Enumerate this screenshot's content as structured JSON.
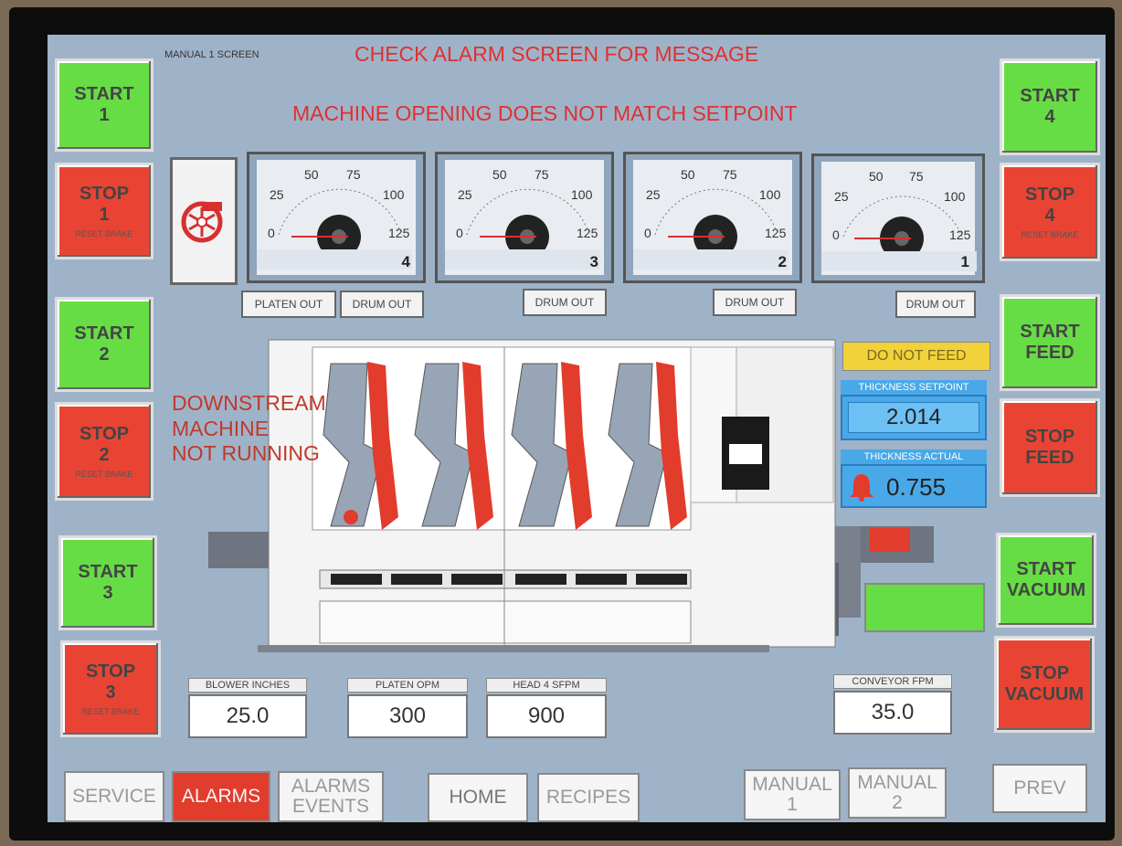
{
  "screen": {
    "title": "MANUAL 1 SCREEN",
    "alarm_banner": "CHECK ALARM SCREEN FOR MESSAGE",
    "warning": "MACHINE OPENING DOES NOT MATCH SETPOINT",
    "downstream_msg": [
      "DOWNSTREAM",
      "MACHINE",
      "NOT RUNNING"
    ]
  },
  "left_buttons": [
    {
      "line1": "START",
      "line2": "1"
    },
    {
      "line1": "STOP",
      "line2": "1",
      "sub": "RESET BRAKE"
    },
    {
      "line1": "START",
      "line2": "2"
    },
    {
      "line1": "STOP",
      "line2": "2",
      "sub": "RESET BRAKE"
    },
    {
      "line1": "START",
      "line2": "3"
    },
    {
      "line1": "STOP",
      "line2": "3",
      "sub": "RESET BRAKE"
    }
  ],
  "right_buttons": [
    {
      "line1": "START",
      "line2": "4"
    },
    {
      "line1": "STOP",
      "line2": "4",
      "sub": "RESET BRAKE"
    },
    {
      "line1": "START",
      "line2": "FEED"
    },
    {
      "line1": "STOP",
      "line2": "FEED"
    },
    {
      "line1": "START",
      "line2": "VACUUM"
    },
    {
      "line1": "STOP",
      "line2": "VACUUM"
    }
  ],
  "gauges": [
    {
      "index": "4",
      "ticks": [
        "0",
        "25",
        "50",
        "75",
        "100",
        "125"
      ]
    },
    {
      "index": "3",
      "ticks": [
        "0",
        "25",
        "50",
        "75",
        "100",
        "125"
      ]
    },
    {
      "index": "2",
      "ticks": [
        "0",
        "25",
        "50",
        "75",
        "100",
        "125"
      ]
    },
    {
      "index": "1",
      "ticks": [
        "0",
        "25",
        "50",
        "75",
        "100",
        "125"
      ]
    }
  ],
  "gauge_buttons": {
    "platen_out": "PLATEN OUT",
    "drum_out_4": "DRUM OUT",
    "drum_out_3": "DRUM OUT",
    "drum_out_2": "DRUM OUT",
    "drum_out_1": "DRUM OUT"
  },
  "feed_status": "DO NOT FEED",
  "thickness": {
    "setpoint_label": "THICKNESS SETPOINT",
    "setpoint_value": "2.014",
    "actual_label": "THICKNESS ACTUAL",
    "actual_value": "0.755"
  },
  "readouts": {
    "blower_label": "BLOWER INCHES",
    "blower_value": "25.0",
    "platen_label": "PLATEN OPM",
    "platen_value": "300",
    "head_label": "HEAD 4 SFPM",
    "head_value": "900",
    "conveyor_label": "CONVEYOR FPM",
    "conveyor_value": "35.0"
  },
  "nav": {
    "service": "SERVICE",
    "alarms": "ALARMS",
    "alarms_events": [
      "ALARMS",
      "EVENTS"
    ],
    "home": "HOME",
    "recipes": "RECIPES",
    "manual1": [
      "MANUAL",
      "1"
    ],
    "manual2": [
      "MANUAL",
      "2"
    ],
    "prev": "PREV"
  },
  "colors": {
    "start_green": "#66dd44",
    "stop_red": "#e94433",
    "warning_red": "#e03030",
    "status_yellow": "#f2d23a",
    "thickness_blue": "#49a8e8"
  }
}
